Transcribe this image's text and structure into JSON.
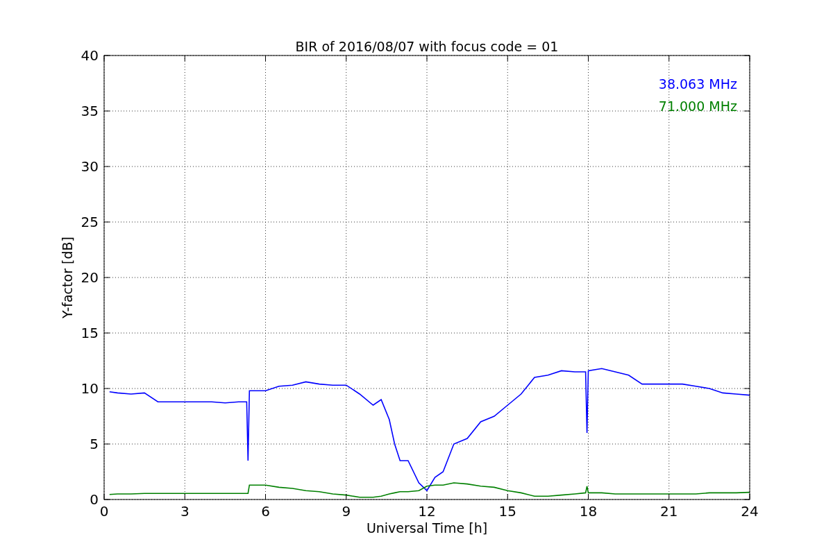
{
  "figure": {
    "chart_data": {
      "type": "line",
      "title": "BIR of 2016/08/07 with focus code = 01",
      "xlabel": "Universal Time [h]",
      "ylabel": "Y-factor [dB]",
      "x": [
        0.2,
        0.5,
        1,
        1.5,
        2,
        2.5,
        3,
        3.5,
        4,
        4.5,
        5,
        5.3,
        5.35,
        5.4,
        6,
        6.5,
        7,
        7.5,
        8,
        8.5,
        9,
        9.5,
        10,
        10.3,
        10.6,
        10.8,
        11,
        11.3,
        11.7,
        12,
        12.3,
        12.6,
        13,
        13.5,
        14,
        14.5,
        15,
        15.5,
        16,
        16.5,
        17,
        17.5,
        17.9,
        17.95,
        18,
        18.5,
        19,
        19.5,
        20,
        20.5,
        21,
        21.5,
        22,
        22.5,
        23,
        23.5,
        24
      ],
      "series": [
        {
          "name": "38.063 MHz",
          "color": "#0000ff",
          "values": [
            9.7,
            9.6,
            9.5,
            9.6,
            8.8,
            8.8,
            8.8,
            8.8,
            8.8,
            8.7,
            8.8,
            8.8,
            3.5,
            9.8,
            9.8,
            10.2,
            10.3,
            10.6,
            10.4,
            10.3,
            10.3,
            9.5,
            8.5,
            9,
            7.2,
            5,
            3.5,
            3.5,
            1.5,
            0.8,
            2,
            2.5,
            5,
            5.5,
            7,
            7.5,
            8.5,
            9.5,
            11,
            11.2,
            11.6,
            11.5,
            11.5,
            6,
            11.6,
            11.8,
            11.5,
            11.2,
            10.4,
            10.4,
            10.4,
            10.4,
            10.2,
            10,
            9.6,
            9.5,
            9.4
          ]
        },
        {
          "name": "71.000 MHz",
          "color": "#008000",
          "values": [
            0.45,
            0.5,
            0.5,
            0.55,
            0.55,
            0.55,
            0.55,
            0.55,
            0.55,
            0.55,
            0.55,
            0.55,
            0.55,
            1.3,
            1.3,
            1.1,
            1,
            0.8,
            0.7,
            0.5,
            0.4,
            0.2,
            0.2,
            0.3,
            0.5,
            0.6,
            0.7,
            0.7,
            0.8,
            1.2,
            1.3,
            1.3,
            1.5,
            1.4,
            1.2,
            1.1,
            0.8,
            0.6,
            0.3,
            0.3,
            0.4,
            0.5,
            0.6,
            1.2,
            0.6,
            0.6,
            0.5,
            0.5,
            0.5,
            0.5,
            0.5,
            0.5,
            0.5,
            0.6,
            0.6,
            0.6,
            0.65
          ]
        }
      ],
      "grid": true,
      "xlim": [
        0,
        24
      ],
      "ylim": [
        0,
        40
      ],
      "xticks": [
        0,
        3,
        6,
        9,
        12,
        15,
        18,
        21,
        24
      ],
      "yticks": [
        0,
        5,
        10,
        15,
        20,
        25,
        30,
        35,
        40
      ]
    }
  }
}
